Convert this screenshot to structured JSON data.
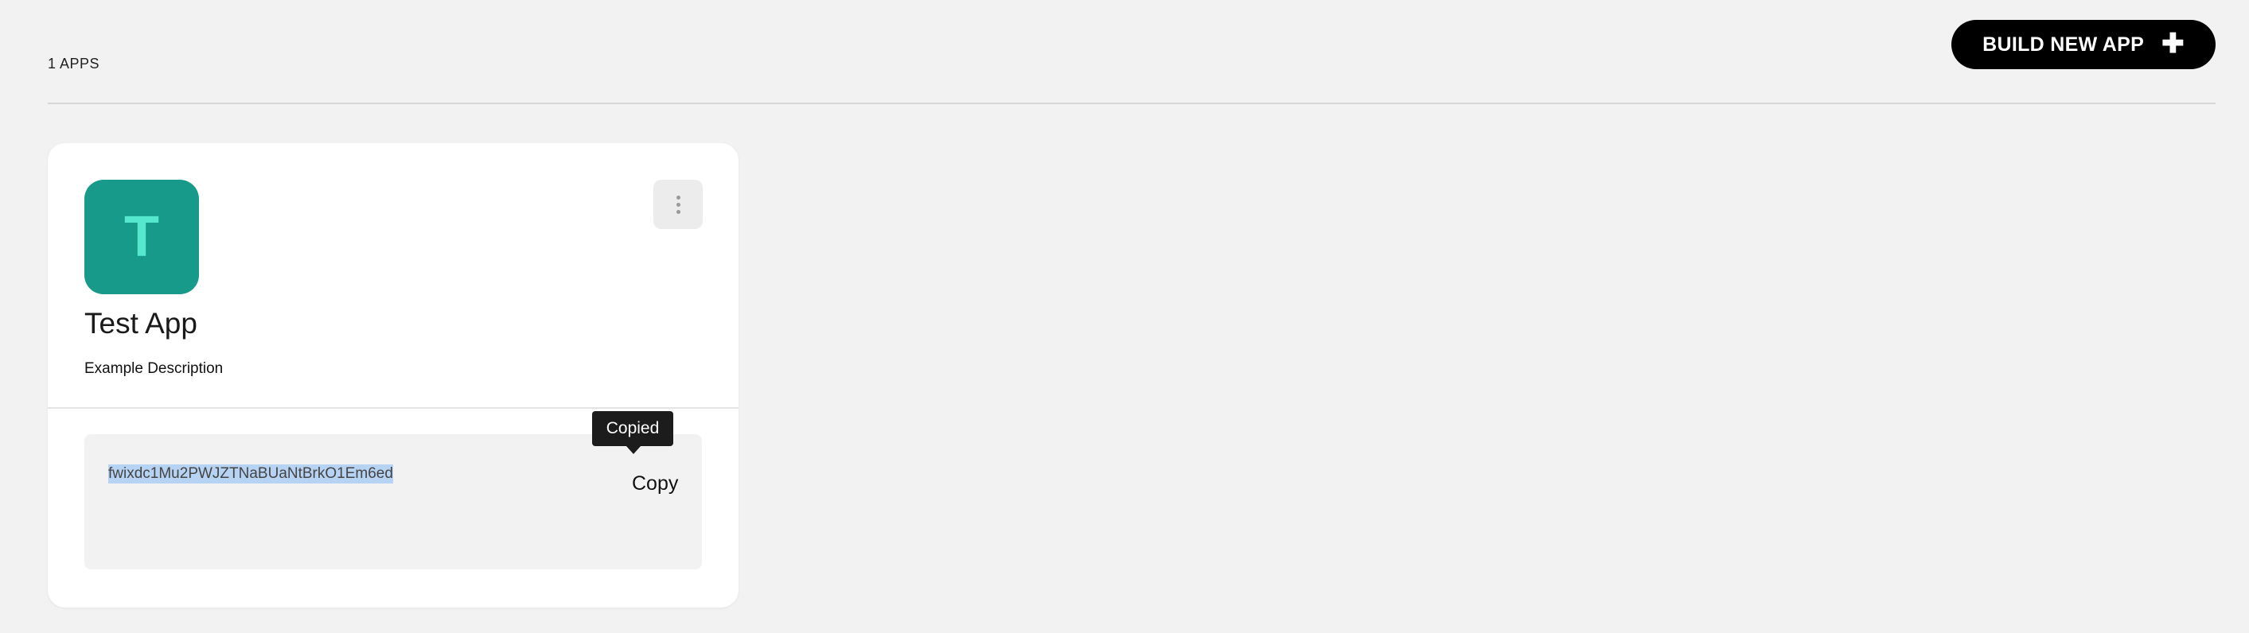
{
  "header": {
    "app_count": "1 APPS",
    "build_button_label": "BUILD NEW APP",
    "build_button_icon": "plus-icon"
  },
  "apps": [
    {
      "icon_letter": "T",
      "icon_bg_color": "#179a89",
      "icon_fg_color": "#55e8cf",
      "name": "Test App",
      "description": "Example Description",
      "api_key": "fwixdc1Mu2PWJZTNaBUaNtBrkO1Em6ed",
      "copy_label": "Copy",
      "tooltip": "Copied",
      "menu_icon": "kebab-menu-icon"
    }
  ]
}
